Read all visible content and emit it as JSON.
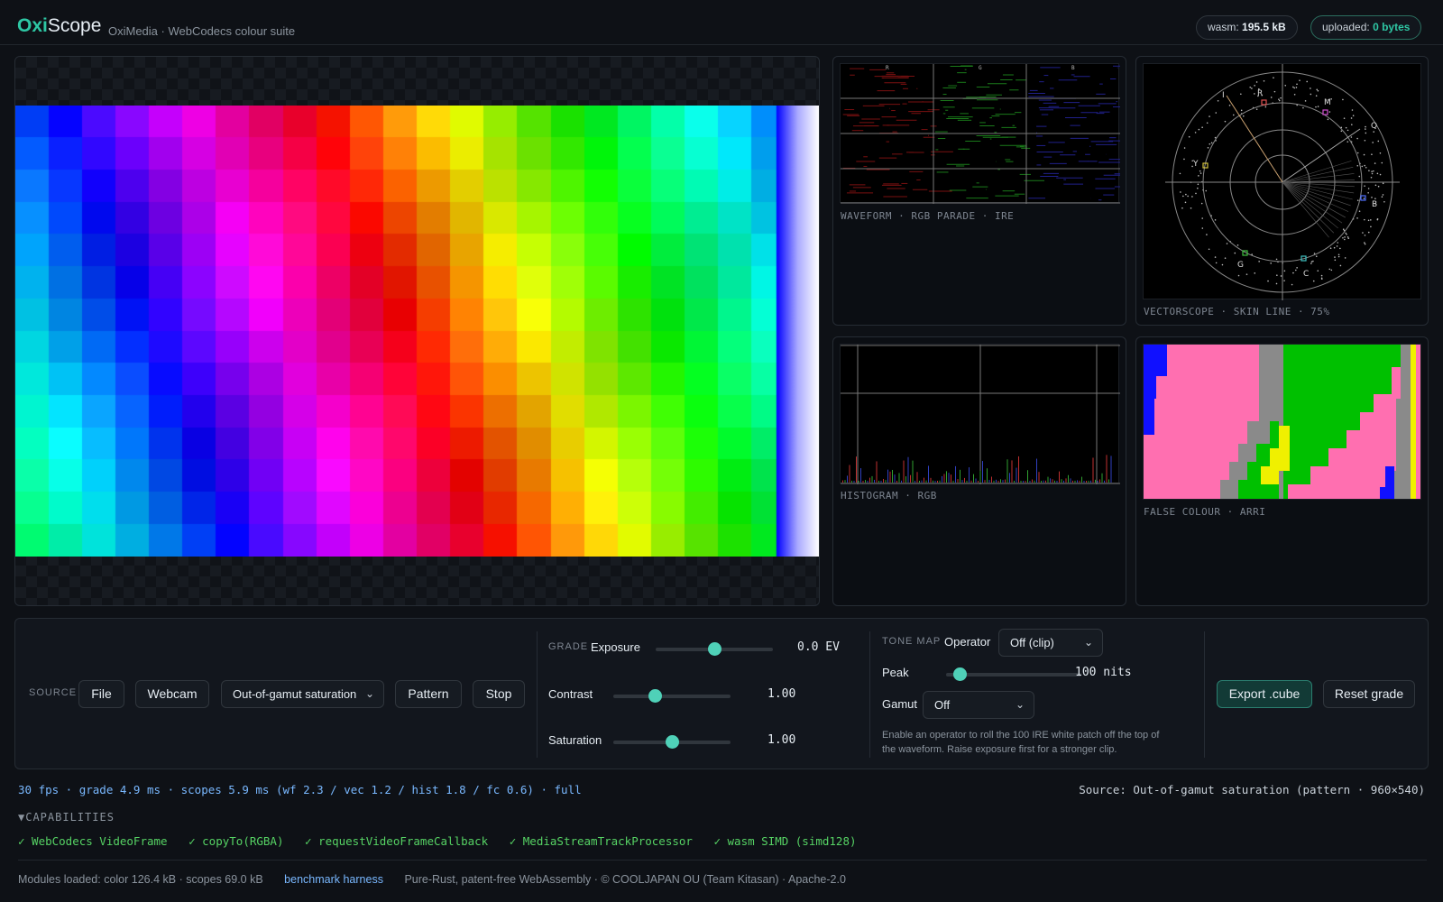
{
  "header": {
    "brand_oxi": "Oxi",
    "brand_scope": "Scope",
    "subtitle": "OxiMedia · WebCodecs colour suite",
    "wasm_label": "wasm:",
    "wasm_value": "195.5 kB",
    "uploaded_label": "uploaded:",
    "uploaded_value": "0 bytes"
  },
  "scopes": {
    "waveform": {
      "label": "WAVEFORM · RGB PARADE · IRE",
      "channels": [
        "R",
        "G",
        "B"
      ]
    },
    "vectorscope": {
      "label": "VECTORSCOPE · SKIN LINE · 75%",
      "targets": [
        "R",
        "M",
        "B",
        "C",
        "G",
        "Y",
        "I",
        "Q"
      ]
    },
    "histogram": {
      "label": "HISTOGRAM · RGB"
    },
    "false_colour": {
      "label": "FALSE COLOUR · ARRI"
    }
  },
  "source": {
    "section": "SOURCE",
    "file": "File",
    "webcam": "Webcam",
    "pattern_select": "Out-of-gamut saturation",
    "pattern": "Pattern",
    "stop": "Stop"
  },
  "grade": {
    "section": "GRADE",
    "exposure": {
      "label": "Exposure",
      "value": "0.0 EV",
      "level": 0.5
    },
    "contrast": {
      "label": "Contrast",
      "value": "1.00",
      "level": 0.35
    },
    "saturation": {
      "label": "Saturation",
      "value": "1.00",
      "level": 0.5
    }
  },
  "tonemap": {
    "section": "TONE MAP",
    "operator_label": "Operator",
    "operator_value": "Off (clip)",
    "peak_label": "Peak",
    "peak_value": "100 nits",
    "peak_level": 0.1,
    "gamut_label": "Gamut",
    "gamut_value": "Off",
    "hint_line1": "Enable an operator to roll the 100 IRE white patch off the top of",
    "hint_line2": "the waveform. Raise exposure first for a stronger clip."
  },
  "actions": {
    "export": "Export .cube",
    "reset": "Reset grade"
  },
  "status": {
    "stats": "30 fps · grade 4.9 ms · scopes 5.9 ms (wf 2.3 / vec 1.2 / hist 1.8 / fc 0.6) · full",
    "source": "Source: Out-of-gamut saturation (pattern · 960×540)"
  },
  "capabilities": {
    "title": "▼CAPABILITIES",
    "items": [
      "✓ WebCodecs VideoFrame",
      "✓ copyTo(RGBA)",
      "✓ requestVideoFrameCallback",
      "✓ MediaStreamTrackProcessor",
      "✓ wasm SIMD (simd128)"
    ]
  },
  "footer": {
    "modules": "Modules loaded: color 126.4 kB · scopes 69.0 kB",
    "link": "benchmark harness",
    "credits": "Pure-Rust, patent-free WebAssembly · © COOLJAPAN OU (Team Kitasan) · Apache-2.0"
  },
  "colors": {
    "accent": "#2ec7a4",
    "slider_thumb": "#4fd1b8",
    "link": "#79b8ff",
    "ok": "#56d364"
  }
}
